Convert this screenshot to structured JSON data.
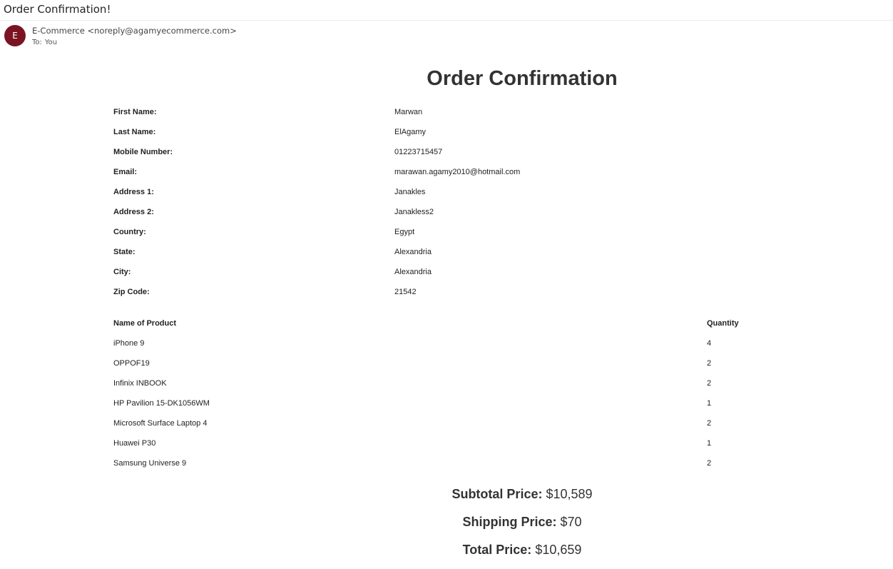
{
  "email": {
    "subject": "Order Confirmation!",
    "avatar_letter": "E",
    "sender": "E-Commerce <noreply@agamyecommerce.com>",
    "to_label": "To:",
    "to_value": "You"
  },
  "order": {
    "heading": "Order Confirmation",
    "customer": [
      {
        "label": "First Name:",
        "value": "Marwan"
      },
      {
        "label": "Last Name:",
        "value": "ElAgamy"
      },
      {
        "label": "Mobile Number:",
        "value": "01223715457"
      },
      {
        "label": "Email:",
        "value": "marawan.agamy2010@hotmail.com"
      },
      {
        "label": "Address 1:",
        "value": "Janakles"
      },
      {
        "label": "Address 2:",
        "value": "Janakless2"
      },
      {
        "label": "Country:",
        "value": "Egypt"
      },
      {
        "label": "State:",
        "value": "Alexandria"
      },
      {
        "label": "City:",
        "value": "Alexandria"
      },
      {
        "label": "Zip Code:",
        "value": "21542"
      }
    ],
    "products_header": {
      "name": "Name of Product",
      "quantity": "Quantity"
    },
    "products": [
      {
        "name": "iPhone 9",
        "quantity": "4"
      },
      {
        "name": "OPPOF19",
        "quantity": "2"
      },
      {
        "name": "Infinix INBOOK",
        "quantity": "2"
      },
      {
        "name": "HP Pavilion 15-DK1056WM",
        "quantity": "1"
      },
      {
        "name": "Microsoft Surface Laptop 4",
        "quantity": "2"
      },
      {
        "name": "Huawei P30",
        "quantity": "1"
      },
      {
        "name": "Samsung Universe 9",
        "quantity": "2"
      }
    ],
    "totals": [
      {
        "label": "Subtotal Price:",
        "value": "$10,589"
      },
      {
        "label": "Shipping Price:",
        "value": "$70"
      },
      {
        "label": "Total Price:",
        "value": "$10,659"
      }
    ]
  },
  "colors": {
    "avatar_bg": "#7a1423",
    "text": "#222222",
    "heading": "#333333"
  }
}
